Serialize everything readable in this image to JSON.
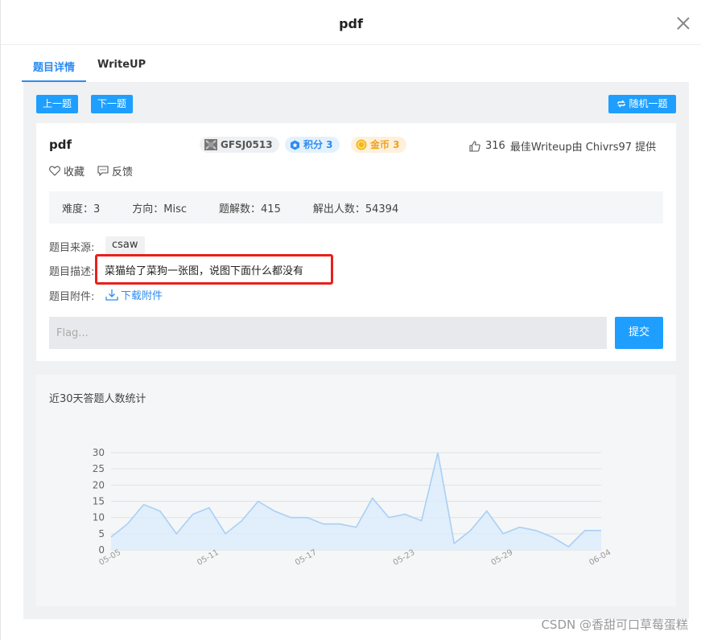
{
  "modal": {
    "title": "pdf"
  },
  "tabs": [
    {
      "label": "题目详情",
      "active": true
    },
    {
      "label": "WriteUP",
      "active": false
    }
  ],
  "nav": {
    "prev": "上一题",
    "next": "下一题",
    "random": "随机一题"
  },
  "challenge": {
    "title": "pdf",
    "id_badge": "GFSJ0513",
    "score_badge": "积分 3",
    "coin_badge": "金币 3",
    "likes": "316",
    "best_writeup": "最佳Writeup由 Chivrs97 提供",
    "favorite": "收藏",
    "feedback": "反馈"
  },
  "stats": {
    "difficulty": "难度：3",
    "direction": "方向：Misc",
    "solutions": "题解数：415",
    "solvers": "解出人数：54394"
  },
  "details": {
    "source_label": "题目来源:",
    "source_value": "csaw",
    "desc_label": "题目描述:",
    "desc_value": "菜猫给了菜狗一张图，说图下面什么都没有",
    "attach_label": "题目附件:",
    "attach_link": "下载附件"
  },
  "flag": {
    "placeholder": "Flag...",
    "submit": "提交"
  },
  "chart_title": "近30天答题人数统计",
  "chart_data": {
    "type": "area",
    "title": "近30天答题人数统计",
    "x": [
      "05-05",
      "05-06",
      "05-07",
      "05-08",
      "05-09",
      "05-10",
      "05-11",
      "05-12",
      "05-13",
      "05-14",
      "05-15",
      "05-16",
      "05-17",
      "05-18",
      "05-19",
      "05-20",
      "05-21",
      "05-22",
      "05-23",
      "05-24",
      "05-25",
      "05-26",
      "05-27",
      "05-28",
      "05-29",
      "05-30",
      "05-31",
      "06-01",
      "06-02",
      "06-03",
      "06-04"
    ],
    "xticks": [
      "05-05",
      "05-11",
      "05-17",
      "05-23",
      "05-29",
      "06-04"
    ],
    "values": [
      4,
      8,
      14,
      12,
      5,
      11,
      13,
      5,
      9,
      15,
      12,
      10,
      10,
      8,
      8,
      7,
      16,
      10,
      11,
      9,
      30,
      2,
      6,
      12,
      5,
      7,
      6,
      4,
      1,
      6,
      6
    ],
    "yticks": [
      0,
      5,
      10,
      15,
      20,
      25,
      30
    ],
    "ylim": [
      0,
      30
    ],
    "grid": true,
    "line_color": "#a8d0f5",
    "fill_color": "#dcecfb"
  },
  "watermark": "CSDN @香甜可口草莓蛋糕"
}
